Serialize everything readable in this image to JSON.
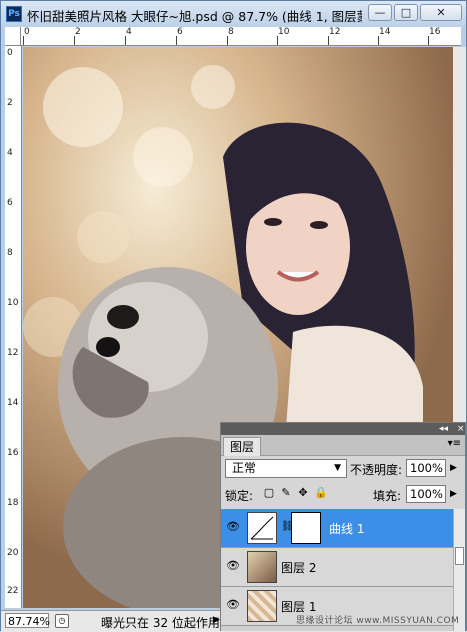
{
  "window": {
    "app_icon": "Ps",
    "title": "怀旧甜美照片风格 大眼仔~旭.psd @ 87.7% (曲线 1, 图层蒙",
    "min_label": "—",
    "max_label": "□",
    "close_label": "✕"
  },
  "ruler_top_labels": [
    "0",
    "2",
    "4",
    "6",
    "8",
    "10",
    "12",
    "14",
    "16"
  ],
  "ruler_left_labels": [
    "0",
    "2",
    "4",
    "6",
    "8",
    "10",
    "12",
    "14",
    "16",
    "18",
    "20",
    "22"
  ],
  "status": {
    "zoom": "87.74%",
    "message": "曝光只在 32 位起作用",
    "arrow": "▶"
  },
  "layers_panel": {
    "tab": "图层",
    "blend_mode": "正常",
    "opacity_label": "不透明度:",
    "opacity_value": "100%",
    "lock_label": "锁定:",
    "fill_label": "填充:",
    "fill_value": "100%",
    "layers": [
      {
        "name": "曲线 1",
        "selected": true
      },
      {
        "name": "图层 2",
        "selected": false
      },
      {
        "name": "图层 1",
        "selected": false
      }
    ]
  },
  "watermark": "思缘设计论坛 www.MISSYUAN.COM",
  "colors": {
    "selection": "#3d8ee6",
    "title_bar": "#bcd0e6"
  }
}
